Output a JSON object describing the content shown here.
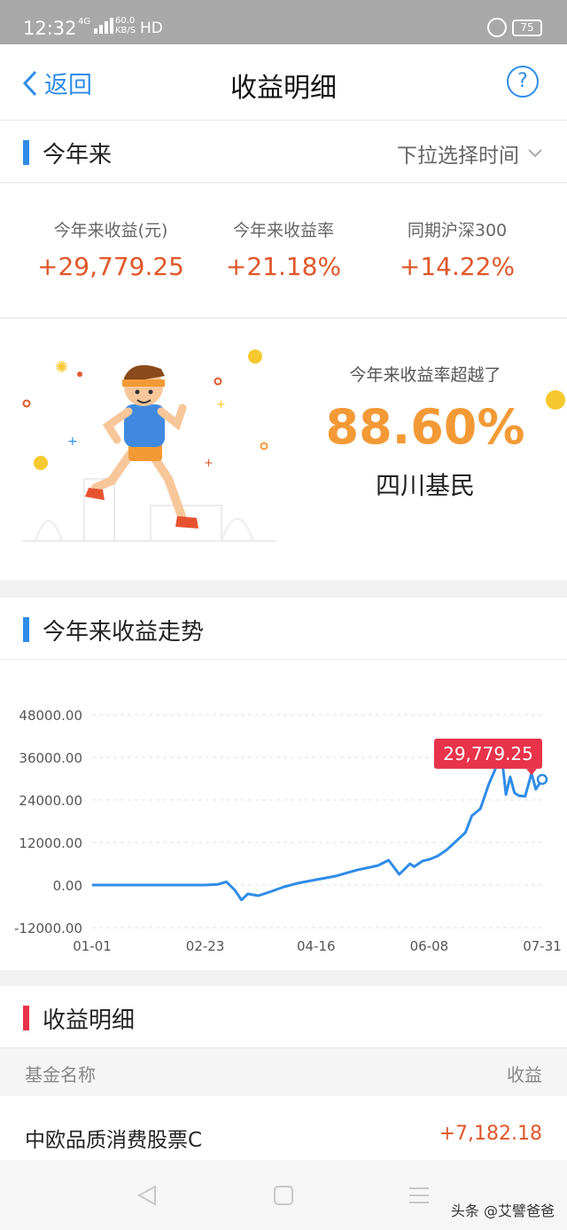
{
  "status_bar": {
    "time": "12:32",
    "network": "4G",
    "speed_value": "60.0",
    "speed_unit": "KB/S",
    "hd": "HD",
    "battery": "75"
  },
  "nav": {
    "back_label": "返回",
    "title": "收益明细",
    "help_icon": "?"
  },
  "ytd_section": {
    "title": "今年来",
    "time_picker_label": "下拉选择时间"
  },
  "stats": [
    {
      "label": "今年来收益(元)",
      "value": "+29,779.25"
    },
    {
      "label": "今年来收益率",
      "value": "+21.18%"
    },
    {
      "label": "同期沪深300",
      "value": "+14.22%"
    }
  ],
  "beat": {
    "caption": "今年来收益率超越了",
    "percent": "88.60%",
    "group": "四川基民"
  },
  "trend_section": {
    "title": "今年来收益走势"
  },
  "chart_data": {
    "type": "line",
    "title": "",
    "xlabel": "",
    "ylabel": "",
    "y_ticks": [
      "48000.00",
      "36000.00",
      "24000.00",
      "12000.00",
      "0.00",
      "-12000.00"
    ],
    "x_ticks": [
      "01-01",
      "02-23",
      "04-16",
      "06-08",
      "07-31"
    ],
    "ylim": [
      -12000,
      48000
    ],
    "grid": true,
    "tooltip": "29,779.25",
    "series": [
      {
        "x": [
          "01-01",
          "01-15",
          "02-01",
          "02-15",
          "02-23",
          "03-01",
          "03-05",
          "03-09",
          "03-12",
          "03-15",
          "03-20",
          "03-25",
          "04-01",
          "04-08",
          "04-16",
          "04-25",
          "05-05",
          "05-15",
          "05-20",
          "05-25",
          "05-30",
          "06-01",
          "06-05",
          "06-08",
          "06-12",
          "06-16",
          "06-20",
          "06-25",
          "06-28",
          "07-02",
          "07-06",
          "07-10",
          "07-12",
          "07-14",
          "07-16",
          "07-18",
          "07-20",
          "07-23",
          "07-26",
          "07-28",
          "07-31"
        ],
        "y": [
          0,
          0,
          0,
          0,
          0,
          200,
          900,
          -1500,
          -4200,
          -2500,
          -3000,
          -2000,
          -500,
          600,
          1500,
          2500,
          4200,
          5500,
          7000,
          3000,
          6000,
          5200,
          6800,
          7200,
          8200,
          9800,
          12000,
          14800,
          19500,
          21500,
          28500,
          34000,
          36500,
          25500,
          30500,
          26000,
          25200,
          25000,
          31500,
          27000,
          29779.25
        ]
      }
    ]
  },
  "detail_section": {
    "title": "收益明细",
    "col_name": "基金名称",
    "col_value": "收益",
    "rows": [
      {
        "name": "中欧品质消费股票C",
        "value": "+7,182.18"
      }
    ]
  },
  "bottom_nav": {
    "watermark": "头条 @艾譬爸爸"
  },
  "colors": {
    "accent_blue": "#2f8ce8",
    "gain_red": "#e0572a",
    "beat_orange": "#f39a36",
    "tooltip_red": "#e8334a"
  }
}
